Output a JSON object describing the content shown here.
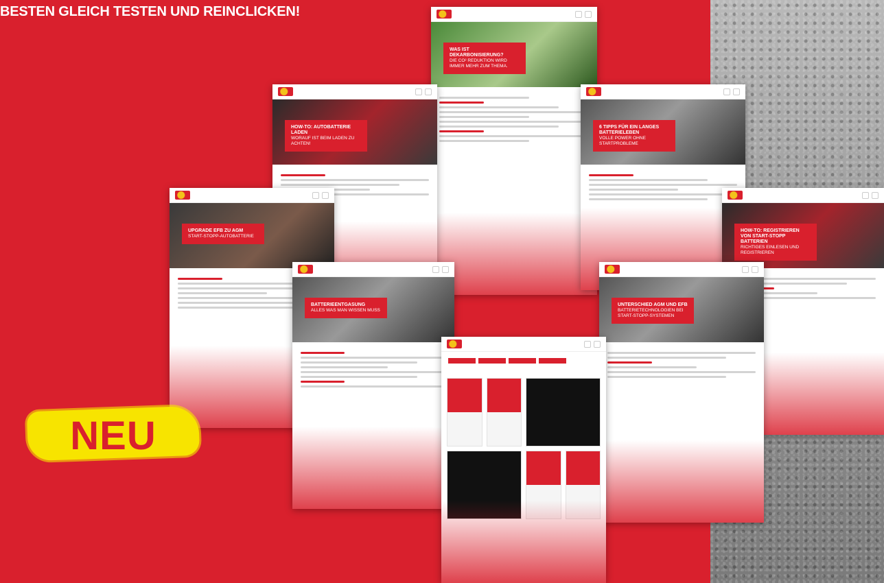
{
  "headline": "BESTEN GLEICH TESTEN UND REINCLICKEN!",
  "badge": "NEU",
  "pages": [
    {
      "title": "WAS IST DEKARBONISIERUNG?",
      "subtitle": "DIE CO² REDUKTION WIRD IMMER MEHR ZUM THEMA."
    },
    {
      "title": "HOW-TO: AUTOBATTERIE LADEN",
      "subtitle": "WORAUF IST BEIM LADEN ZU ACHTEN!"
    },
    {
      "title": "6 TIPPS FÜR EIN LANGES BATTERIELEBEN",
      "subtitle": "VOLLE POWER OHNE STARTPROBLEME"
    },
    {
      "title": "UPGRADE EFB ZU AGM",
      "subtitle": "START-STOPP-AUTOBATTERIE"
    },
    {
      "title": "BATTERIEENTGASUNG",
      "subtitle": "ALLES WAS MAN WISSEN MUSS"
    },
    {
      "title": "UNTERSCHIED AGM UND EFB",
      "subtitle": "BATTERIETECHNOLOGIEN BEI START-STOPP-SYSTEMEN"
    },
    {
      "title": "HOW-TO: REGISTRIEREN VON START-STOPP BATTERIEN",
      "subtitle": "RICHTIGES EINLESEN UND REGISTRIEREN"
    }
  ],
  "colors": {
    "brand_red": "#d9202d",
    "highlight_yellow": "#f7e400"
  }
}
